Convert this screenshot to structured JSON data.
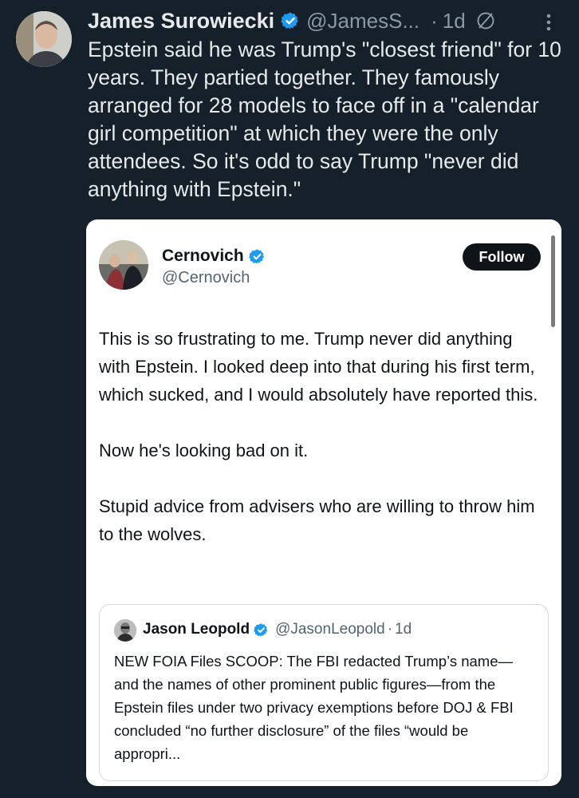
{
  "tweet": {
    "author_name": "James Surowiecki",
    "handle": "@JamesS...",
    "separator": "·",
    "time": "1d",
    "text": "Epstein said he was Trump's \"closest friend\" for 10 years. They partied together. They famously arranged for 28 models to face off in a \"calendar girl competition\" at which they were the only attendees. So it's odd to say Trump \"never did anything with Epstein.\"",
    "icons": [
      "verified-badge-icon",
      "no-sign-icon",
      "more-options-icon"
    ]
  },
  "quoted": {
    "author_name": "Cernovich",
    "handle": "@Cernovich",
    "follow_label": "Follow",
    "paragraph1": "This is so frustrating to me. Trump never did anything with Epstein. I looked deep into that during his first term, which sucked, and I would absolutely have reported this.",
    "paragraph2": "Now he's looking bad on it.",
    "paragraph3": "Stupid advice from advisers who are willing to throw him to the wolves."
  },
  "nested": {
    "author_name": "Jason Leopold",
    "handle": "@JasonLeopold",
    "separator": "·",
    "time": "1d",
    "text": "NEW FOIA Files SCOOP: The FBI redacted Trump’s name—and the names of other prominent public figures—from the Epstein files under two privacy exemptions before DOJ & FBI concluded  “no further disclosure” of the files “would be appropri..."
  },
  "colors": {
    "background": "#15202b",
    "verified_blue": "#1d9bf0",
    "text_light": "#e7e9ea",
    "text_muted": "#8b98a5",
    "follow_button": "#0f1419"
  }
}
